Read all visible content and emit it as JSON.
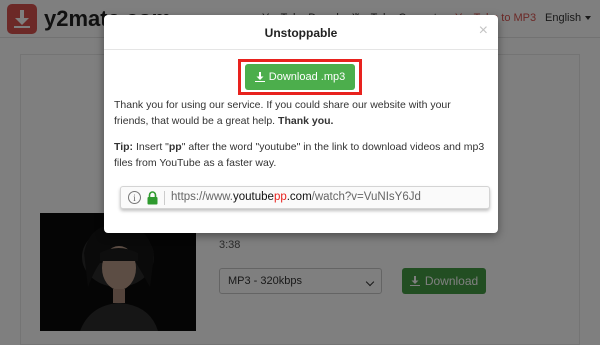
{
  "header": {
    "logo_text": "y2mate.com",
    "nav": [
      "YouTube Downloader",
      "YouTube Converter",
      "YouTube to MP3"
    ],
    "language": "English"
  },
  "video": {
    "duration": "3:38",
    "quality_selected": "MP3 - 320kbps",
    "download_label": "Download"
  },
  "modal": {
    "title": "Unstoppable",
    "close_symbol": "×",
    "download_mp3_label": "Download .mp3",
    "thanks_text": "Thank you for using our service. If you could share our website with your friends, that would be a great help.",
    "thanks_bold": "Thank you.",
    "tip_label": "Tip:",
    "tip_text_1": "Insert \"",
    "tip_pp": "pp",
    "tip_text_2": "\" after the word \"youtube\" in the link to download videos and mp3 files from YouTube as a faster way.",
    "url_prefix": "https://www.",
    "url_domain_1": "youtube",
    "url_pp": "pp",
    "url_domain_2": ".com",
    "url_suffix": "/watch?v=VuNIsY6Jd"
  },
  "colors": {
    "brand_red": "#d9534f",
    "download_green": "#4cae4c",
    "highlight_red": "#e8221e"
  },
  "icons": [
    "download-icon",
    "info-icon",
    "lock-icon",
    "close-icon",
    "chevron-down-icon"
  ]
}
